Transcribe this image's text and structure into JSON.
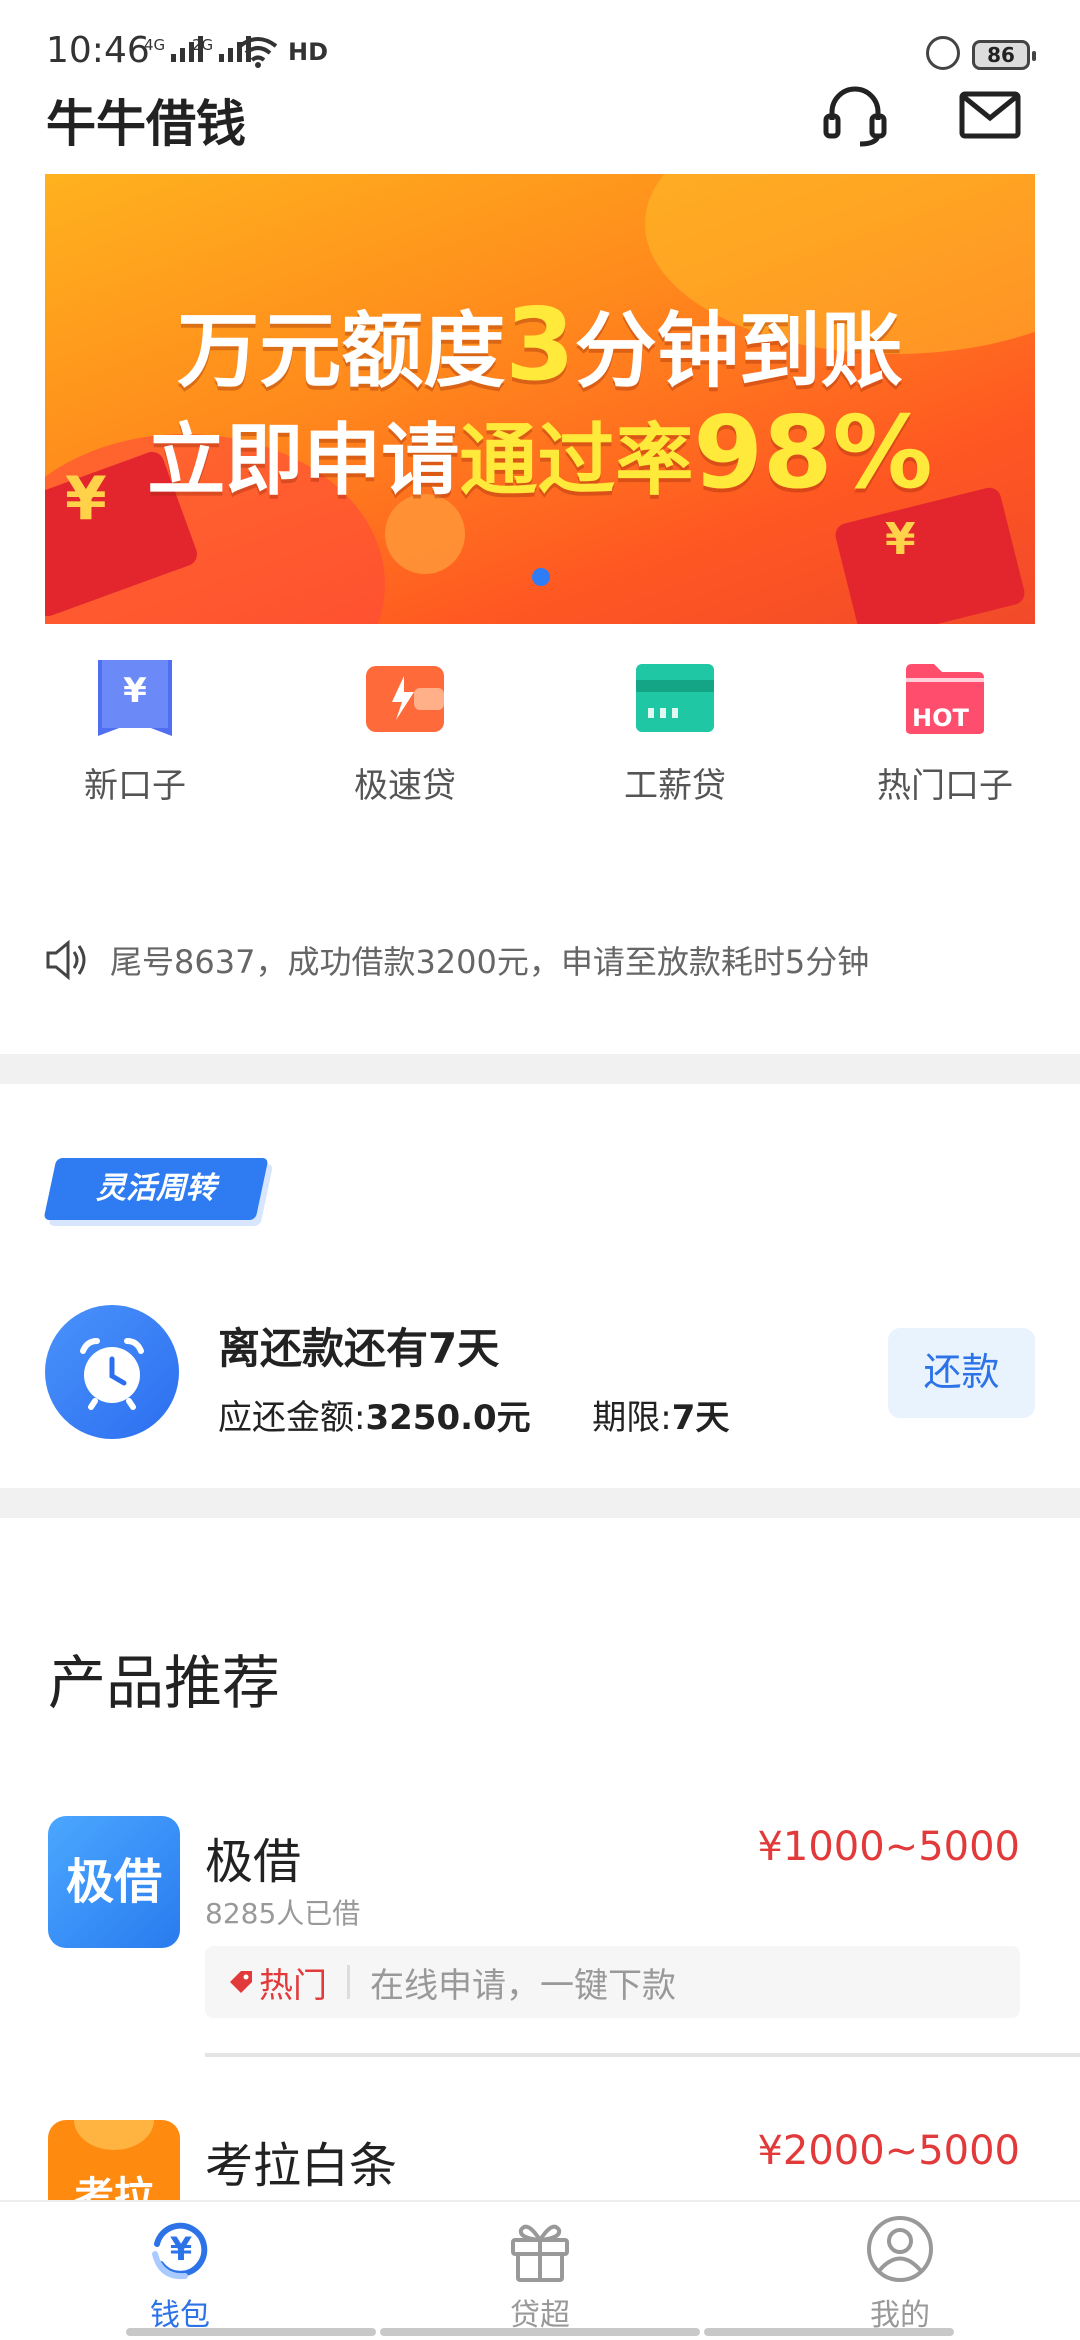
{
  "status_bar": {
    "time": "10:46",
    "network1": "4G",
    "network2": "2G",
    "hd": "HD",
    "battery": "86"
  },
  "header": {
    "title": "牛牛借钱",
    "support_icon": "headset-icon",
    "message_icon": "mail-icon"
  },
  "banner": {
    "line1_a": "万元额度",
    "line1_b": "3",
    "line1_c": "分钟到账",
    "line2_a": "立即申请",
    "line2_b": "通过率",
    "line2_c": "98%",
    "active_dot_color": "#2e7cf6"
  },
  "quick_entries": [
    {
      "label": "新口子",
      "icon": "yen-bookmark-icon",
      "color": "#4f6ef2"
    },
    {
      "label": "极速贷",
      "icon": "lightning-wallet-icon",
      "color": "#ff6a3a"
    },
    {
      "label": "工薪贷",
      "icon": "card-icon",
      "color": "#1fc7a4"
    },
    {
      "label": "热门口子",
      "icon": "hot-folder-icon",
      "color": "#ff4d6d",
      "badge": "HOT"
    }
  ],
  "notice": {
    "icon": "speaker-icon",
    "text": "尾号8637，成功借款3200元，申请至放款耗时5分钟"
  },
  "repay": {
    "tag": "灵活周转",
    "icon": "alarm-clock-icon",
    "title": "离还款还有7天",
    "amount_label": "应还金额:",
    "amount": "3250.0元",
    "term_label": "期限:",
    "term": "7天",
    "button": "还款"
  },
  "products": {
    "title": "产品推荐",
    "items": [
      {
        "name": "极借",
        "logo_text": "极借",
        "count": "8285人已借",
        "range": "¥1000~5000",
        "tag_icon": "price-tag-icon",
        "tag": "热门",
        "desc": "在线申请，一键下款"
      },
      {
        "name": "考拉白条",
        "logo_text": "考拉",
        "range": "¥2000~5000"
      }
    ]
  },
  "nav": {
    "items": [
      {
        "label": "钱包",
        "icon": "wallet-yen-icon",
        "active": true
      },
      {
        "label": "贷超",
        "icon": "gift-icon",
        "active": false
      },
      {
        "label": "我的",
        "icon": "user-icon",
        "active": false
      }
    ]
  },
  "colors": {
    "accent": "#2d73e8",
    "price": "#e23a3a"
  }
}
